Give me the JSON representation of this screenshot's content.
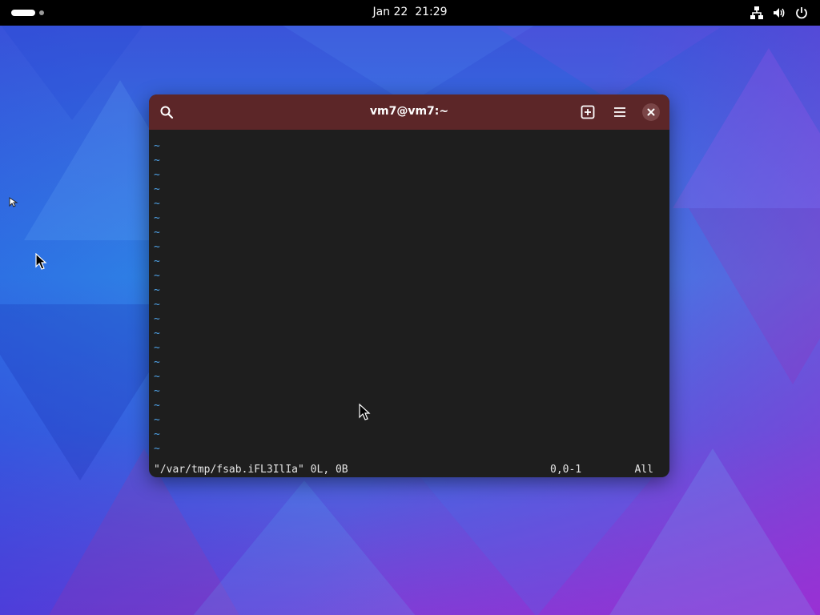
{
  "topbar": {
    "clock_date": "Jan 22",
    "clock_time": "21:29",
    "icons": [
      "network-icon",
      "volume-icon",
      "power-icon"
    ]
  },
  "window": {
    "title": "vm7@vm7:~",
    "buttons": [
      "search-icon",
      "new-tab-icon",
      "menu-icon",
      "close-icon"
    ],
    "header_color": "#5c2628"
  },
  "vim": {
    "empty_line_marker": "~",
    "tilde_color": "#4fa3e8",
    "status_file": "\"/var/tmp/fsab.iFL3IlIa\" 0L, 0B",
    "status_position": "0,0-1",
    "status_scroll": "All"
  }
}
